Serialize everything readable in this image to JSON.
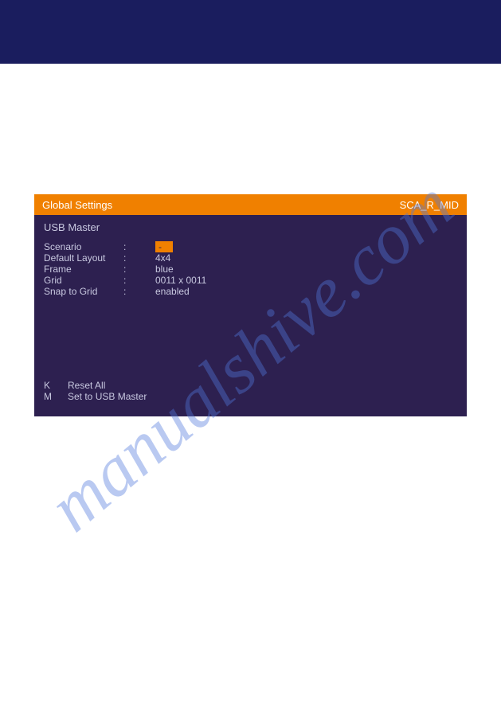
{
  "watermark": "manualshive.com",
  "window": {
    "title": "Global Settings",
    "identifier": "SCA_R_MID",
    "sectionHeader": "USB Master",
    "settings": [
      {
        "label": "Scenario",
        "separator": ":",
        "value": "-",
        "highlighted": true
      },
      {
        "label": "Default Layout",
        "separator": ":",
        "value": "4x4",
        "highlighted": false
      },
      {
        "label": "Frame",
        "separator": ":",
        "value": "blue",
        "highlighted": false
      },
      {
        "label": "Grid",
        "separator": ":",
        "value": "0011 x 0011",
        "highlighted": false
      },
      {
        "label": "Snap to Grid",
        "separator": ":",
        "value": "enabled",
        "highlighted": false
      }
    ],
    "commands": [
      {
        "key": "K",
        "action": "Reset All"
      },
      {
        "key": "M",
        "action": "Set to USB Master"
      }
    ]
  }
}
